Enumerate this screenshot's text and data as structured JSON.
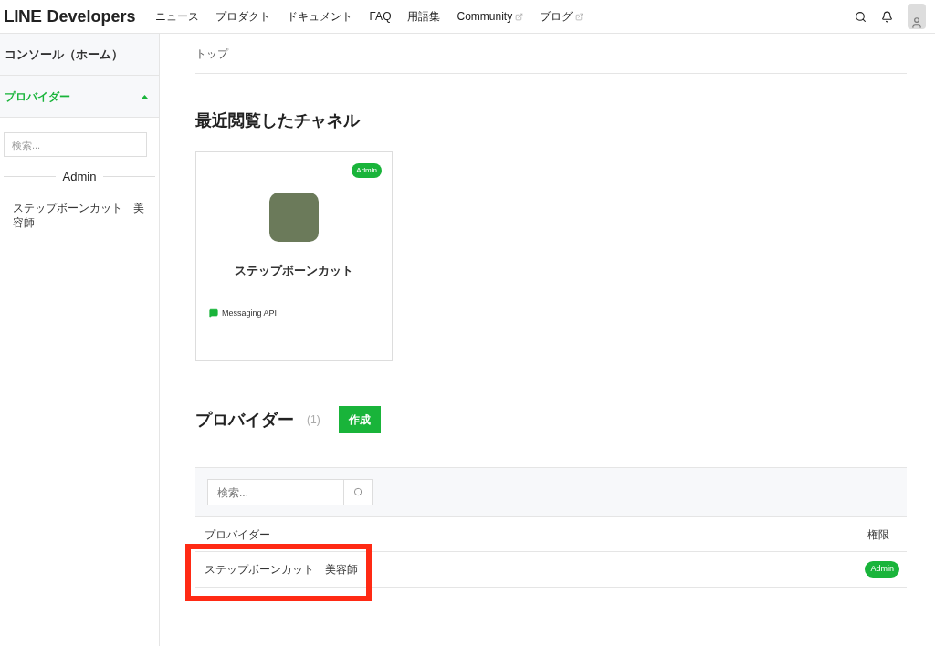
{
  "header": {
    "logo_bold": "LINE",
    "logo_text": "Developers",
    "nav": [
      {
        "label": "ニュース",
        "external": false
      },
      {
        "label": "プロダクト",
        "external": false
      },
      {
        "label": "ドキュメント",
        "external": false
      },
      {
        "label": "FAQ",
        "external": false
      },
      {
        "label": "用語集",
        "external": false
      },
      {
        "label": "Community",
        "external": true
      },
      {
        "label": "ブログ",
        "external": true
      }
    ]
  },
  "sidebar": {
    "home": "コンソール（ホーム）",
    "section": {
      "label": "プロバイダー",
      "expanded": true
    },
    "search": {
      "placeholder": "検索..."
    },
    "group": "Admin",
    "items": [
      {
        "label": "ステップボーンカット　美容師"
      }
    ]
  },
  "breadcrumb": "トップ",
  "recent": {
    "title": "最近閲覧したチャネル",
    "channels": [
      {
        "role": "Admin",
        "name": "ステップボーンカット",
        "type": "Messaging API"
      }
    ]
  },
  "providers": {
    "title": "プロバイダー",
    "count": "(1)",
    "create_button": "作成",
    "search": {
      "placeholder": "検索..."
    },
    "columns": [
      "プロバイダー",
      "権限"
    ],
    "rows": [
      {
        "name": "ステップボーンカット　美容師",
        "role": "Admin",
        "highlighted": true
      }
    ]
  }
}
